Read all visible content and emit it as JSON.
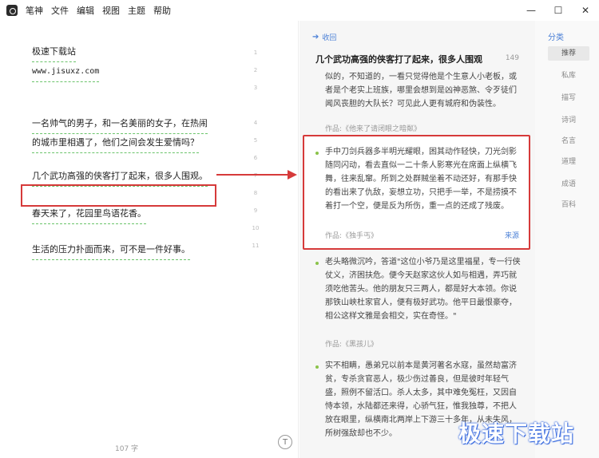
{
  "menu": [
    "笔神",
    "文件",
    "编辑",
    "视图",
    "主题",
    "帮助"
  ],
  "window": {
    "minimize": "—",
    "maximize": "☐",
    "close": "✕"
  },
  "editor": {
    "paragraphs": [
      {
        "lines": [
          "极速下载站",
          "www.jisuxz.com"
        ]
      },
      {
        "lines": [
          "一名帅气的男子，和一名美丽的女子，在热闹",
          "的城市里相遇了，他们之间会发生爱情吗？"
        ]
      },
      {
        "lines": [
          "几个武功高强的侠客打了起来，很多人围观。"
        ]
      },
      {
        "lines": [
          "春天来了，花园里鸟语花香。"
        ]
      },
      {
        "lines": [
          "生活的压力扑面而来，可不是一件好事。"
        ]
      }
    ],
    "line_numbers": [
      "1",
      "2",
      "3",
      "4",
      "5",
      "6",
      "7",
      "8",
      "9",
      "10",
      "11"
    ],
    "word_count": "107 字",
    "t_button": "T"
  },
  "panel": {
    "collapse": "收回",
    "title": "几个武功高强的侠客打了起来，很多人围观",
    "count": "149",
    "cards": [
      {
        "text": "似的，不知道的，一看只觉得他是个生意人小老板，或者是个老实上班族，哪里会想到是凶神恶煞、令歹徒们闻风丧胆的大队长？可见此人更有城府和伪装性。",
        "source": "作品:《他来了请闭眼之暗粼》"
      },
      {
        "text": "手中刀剑兵器多半明光耀眼，困其动作轻快，刀光剑影随同闪动，看去直似一二十条人影寒光在席面上纵横飞舞，往来乱窜。所到之处群贼坐着不动还好，有那手快的看出来了仇敌，妄想立功，只把手一举，不是捞摸不着打一个空，便是反为所伤，重一点的还成了残废。",
        "source": "作品:《独手丐》",
        "link": "来源"
      },
      {
        "text": "老头略微沉吟，答道\"这位小爷乃是这里福星，专一行侠仗义，济困扶危。便今天赵家这伙人如与相遇，弄巧就须吃他苦头。他的朋友只三两人，都是好大本领。你说那铁山峡杜家官人，便有极好武功。他平日最恨豪夺，相公这样文雅是会相交，实在奇怪。\"",
        "source": "作品:《黑孩儿》"
      },
      {
        "text": "实不相瞒，愚弟兄以前本是黄河著名水寇，虽然劫富济贫，专杀贪官恶人，极少伤过善良，但是彼时年轻气盛，照例不留活口。杀人太多，其中难免冤枉，又因自恃本领，水陆都还来得，心骄气狂，惟我独尊，不把人放在眼里，纵横南北两岸上下游三十多年，从未失风，所树强敌却也不少。",
        "source": "作品:《黑孩儿》"
      }
    ]
  },
  "categories": {
    "title": "分类",
    "items": [
      "推荐",
      "私库",
      "描写",
      "诗词",
      "名言",
      "道理",
      "成语",
      "百科"
    ],
    "active": 0
  },
  "watermark": "极速下载站",
  "colors": {
    "accent": "#4a7fd6",
    "highlight": "#d63a3a",
    "underline": "#6bc46b"
  }
}
